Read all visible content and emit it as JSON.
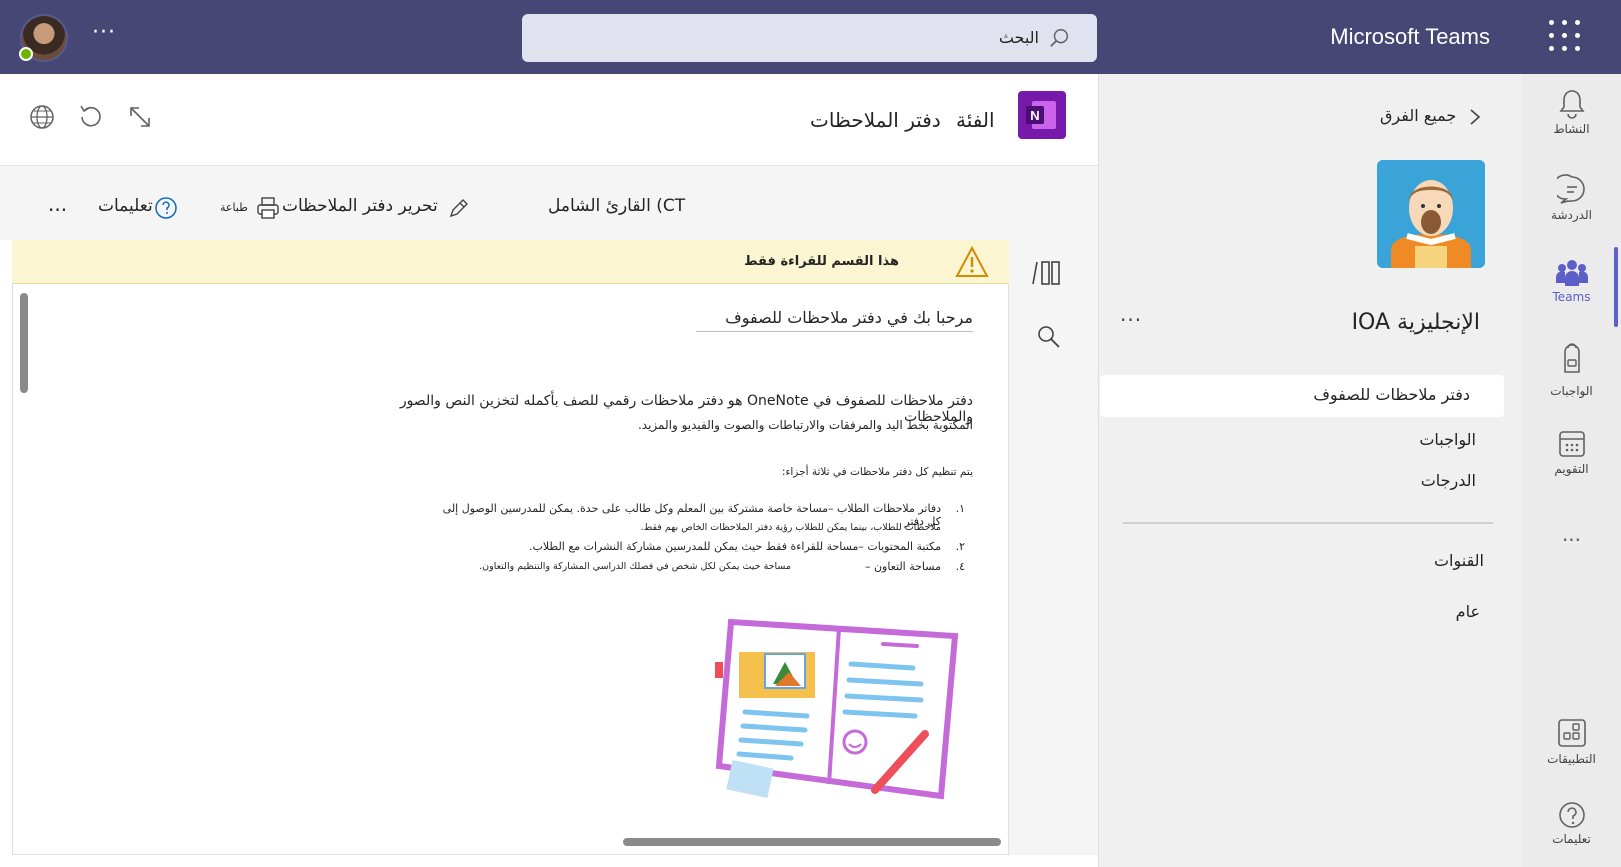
{
  "app": {
    "title": "Microsoft Teams"
  },
  "search": {
    "placeholder": "البحث"
  },
  "rail": {
    "items": [
      {
        "label": "النشاط",
        "icon": "bell-icon"
      },
      {
        "label": "الدردشة",
        "icon": "chat-icon"
      },
      {
        "label": "Teams",
        "icon": "teams-icon"
      },
      {
        "label": "الواجبات",
        "icon": "backpack-icon"
      },
      {
        "label": "التقويم",
        "icon": "calendar-icon"
      },
      {
        "label": "...",
        "icon": "more-icon"
      },
      {
        "label": "التطبيقات",
        "icon": "apps-icon"
      },
      {
        "label": "تعليمات",
        "icon": "help-icon"
      }
    ]
  },
  "team_panel": {
    "back_label": "جميع الفرق",
    "team_name": "IOA الإنجليزية",
    "nav": [
      {
        "label": "دفتر ملاحظات للصفوف",
        "active": true
      },
      {
        "label": "الواجبات"
      },
      {
        "label": "الدرجات"
      }
    ],
    "channels_header": "القنوات",
    "channels": [
      {
        "label": "عام"
      }
    ]
  },
  "header": {
    "tab_category": "الفئة",
    "tab_notebook": "دفتر الملاحظات"
  },
  "toolbar": {
    "immersive_reader": "القارئ الشامل (CT",
    "edit_notebook": "تحرير دفتر الملاحظات",
    "print": "طباعة",
    "help": "تعليمات",
    "more": "..."
  },
  "banner": {
    "text": "هذا القسم للقراءة فقط"
  },
  "page": {
    "title": "مرحبا بك في دفتر ملاحظات للصفوف",
    "intro_line1": "دفتر ملاحظات للصفوف في OneNote هو دفتر ملاحظات رقمي للصف بأكمله لتخزين النص والصور والملاحظات",
    "intro_line2": "المكتوبة بخط اليد والمرفقات والارتباطات والصوت والفيديو والمزيد.",
    "parts_intro": "يتم تنظيم كل دفتر ملاحظات في ثلاثة أجزاء:",
    "list": [
      {
        "num": "١.",
        "line1": "دفاتر ملاحظات الطلاب –مساحة خاصة مشتركة بين المعلم وكل طالب على حدة. يمكن للمدرسين الوصول إلى كل دفتر",
        "line2": "ملاحظات للطلاب، بينما يمكن للطلاب رؤية دفتر الملاحظات الخاص بهم فقط."
      },
      {
        "num": "٢.",
        "line1": "مكتبة المحتويات –مساحة للقراءة فقط حيث يمكن للمدرسين مشاركة النشرات مع الطلاب."
      },
      {
        "num": "٤.",
        "label": "مساحة التعاون –",
        "line1": "مساحة حيث يمكن لكل شخص في فصلك الدراسي المشاركة والتنظيم والتعاون."
      }
    ]
  },
  "colors": {
    "titlebar": "#464775",
    "accent": "#5b5fc7",
    "onenote": "#7719aa",
    "banner": "#fbf6d1"
  }
}
